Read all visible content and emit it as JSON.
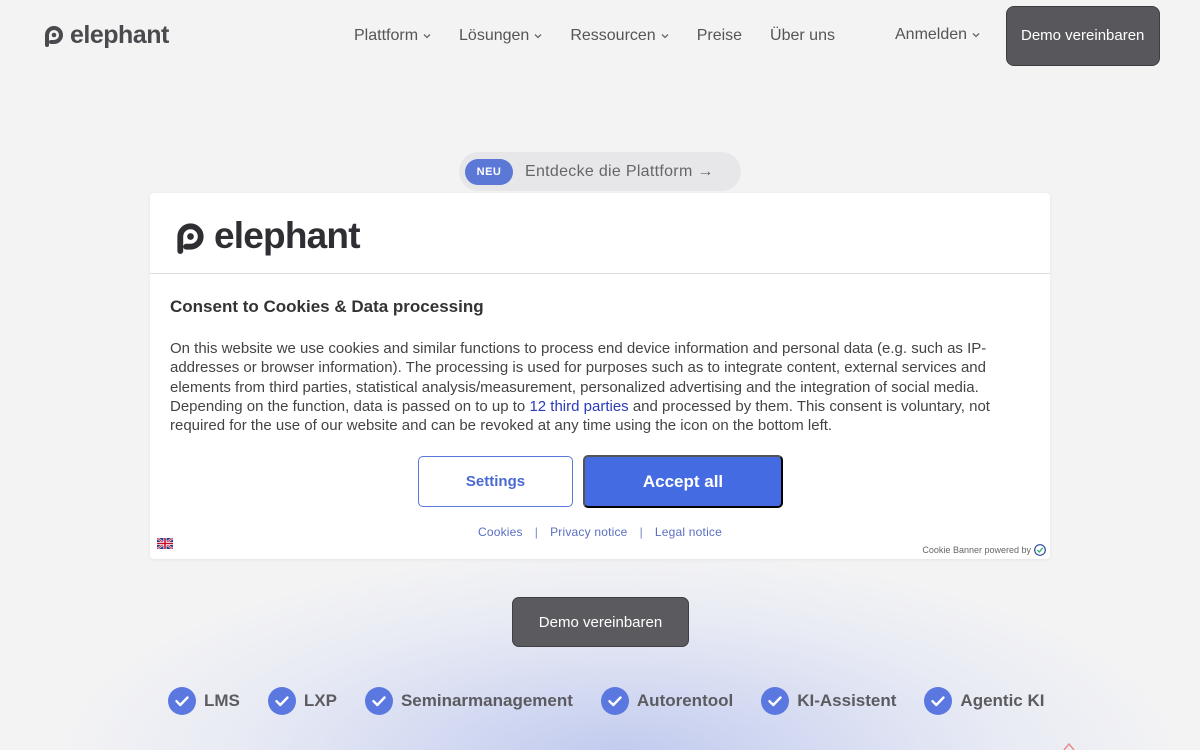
{
  "header": {
    "logo_text": "elephant",
    "nav": [
      {
        "label": "Plattform",
        "has_menu": true
      },
      {
        "label": "Lösungen",
        "has_menu": true
      },
      {
        "label": "Ressourcen",
        "has_menu": true
      },
      {
        "label": "Preise",
        "has_menu": false
      },
      {
        "label": "Über uns",
        "has_menu": false
      }
    ],
    "login_label": "Anmelden",
    "demo_button": "Demo vereinbaren"
  },
  "announcement": {
    "badge": "NEU",
    "text": "Entdecke die Plattform →"
  },
  "cookie_banner": {
    "logo_text": "elephant",
    "title": "Consent to Cookies & Data processing",
    "body_before_link": "On this website we use cookies and similar functions to process end device information and personal data (e.g. such as IP-addresses or browser information). The processing is used for purposes such as to integrate content, external services and elements from third parties, statistical analysis/measurement, personalized advertising and the integration of social media. Depending on the function, data is passed on to up to ",
    "body_link": "12 third parties",
    "body_after_link": " and processed by them. This consent is voluntary, not required for the use of our website and can be revoked at any time using the icon on the bottom left.",
    "settings_button": "Settings",
    "accept_button": "Accept all",
    "links": [
      "Cookies",
      "Privacy notice",
      "Legal notice"
    ],
    "link_separator": "|",
    "powered_by": "Cookie Banner powered by"
  },
  "hero": {
    "demo_button": "Demo vereinbaren"
  },
  "features": [
    "LMS",
    "LXP",
    "Seminarmanagement",
    "Autorentool",
    "KI-Assistent",
    "Agentic KI"
  ],
  "colors": {
    "accent_blue": "#456be3",
    "badge_blue": "#5b78d6",
    "dark_button": "#57575c",
    "check_blue": "#5b78e0"
  },
  "icons": {
    "logo": "elephant-logo-icon",
    "chevron": "chevron-down-icon",
    "check": "check-circle-icon",
    "flag": "uk-flag-icon",
    "powered_logo": "shield-check-icon"
  }
}
